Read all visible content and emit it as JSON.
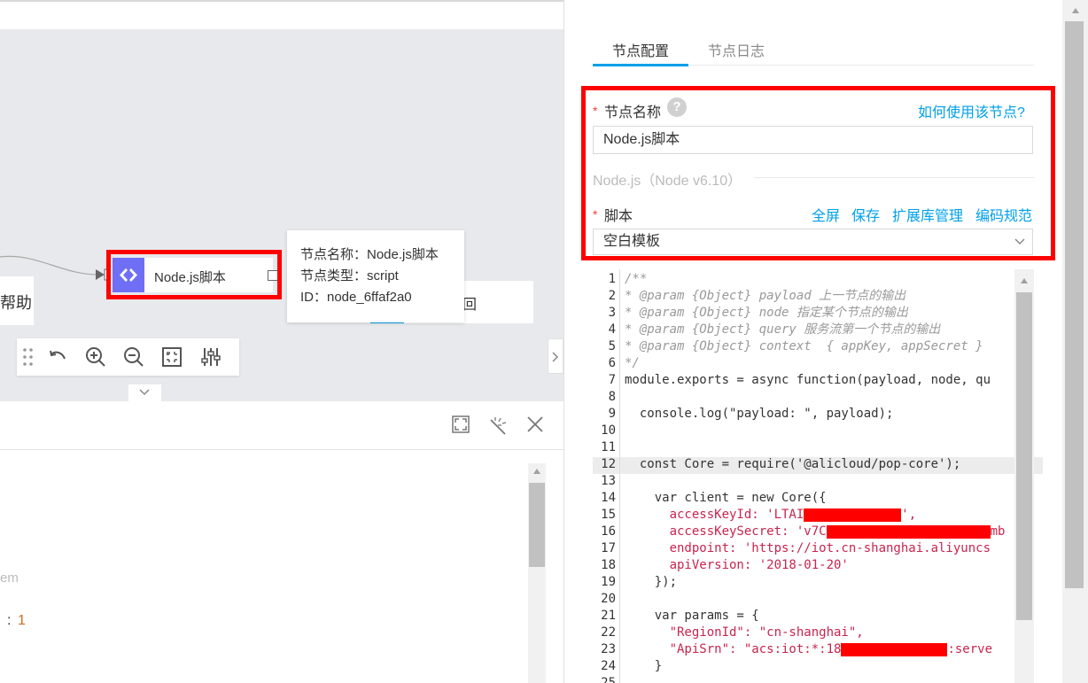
{
  "canvas": {
    "help_text": "帮助",
    "return_text": "回",
    "node_label": "Node.js脚本",
    "tooltip": {
      "name": "节点名称：Node.js脚本",
      "type": "节点类型：script",
      "id": "ID：node_6ffaf2a0"
    },
    "toolbar_icons": [
      "drag-handle-icon",
      "undo-icon",
      "zoom-in-icon",
      "zoom-out-icon",
      "fit-view-icon",
      "settings-sliders-icon"
    ]
  },
  "bottom_panel": {
    "text_fragment": "em",
    "value_prefix": ":",
    "value": "1"
  },
  "right_panel": {
    "tabs": [
      {
        "label": "节点配置",
        "active": true
      },
      {
        "label": "节点日志",
        "active": false
      }
    ],
    "node_name": {
      "label": "节点名称",
      "help_glyph": "?",
      "how_to_link": "如何使用该节点?",
      "value": "Node.js脚本"
    },
    "runtime": "Node.js（Node v6.10）",
    "script": {
      "label": "脚本",
      "actions": [
        "全屏",
        "保存",
        "扩展库管理",
        "编码规范"
      ],
      "template": "空白模板"
    },
    "code_lines": [
      {
        "n": "1",
        "text": "/**"
      },
      {
        "n": "2",
        "text": "* @param {Object} payload 上一节点的输出"
      },
      {
        "n": "3",
        "text": "* @param {Object} node 指定某个节点的输出"
      },
      {
        "n": "4",
        "text": "* @param {Object} query 服务流第一个节点的输出"
      },
      {
        "n": "5",
        "text": "* @param {Object} context  { appKey, appSecret }"
      },
      {
        "n": "6",
        "text": "*/"
      },
      {
        "n": "7",
        "text": "module.exports = async function(payload, node, qu"
      },
      {
        "n": "8",
        "text": ""
      },
      {
        "n": "9",
        "text": "  console.log(\"payload: \", payload);"
      },
      {
        "n": "10",
        "text": ""
      },
      {
        "n": "11",
        "text": ""
      },
      {
        "n": "12",
        "text": "  const Core = require('@alicloud/pop-core');"
      },
      {
        "n": "13",
        "text": ""
      },
      {
        "n": "14",
        "text": "    var client = new Core({"
      },
      {
        "n": "15",
        "text": "      accessKeyId: 'LTAI"
      },
      {
        "n": "16",
        "text": "      accessKeySecret: 'v7C"
      },
      {
        "n": "17",
        "text": "      endpoint: 'https://iot.cn-shanghai.aliyuncs"
      },
      {
        "n": "18",
        "text": "      apiVersion: '2018-01-20'"
      },
      {
        "n": "19",
        "text": "    });"
      },
      {
        "n": "20",
        "text": ""
      },
      {
        "n": "21",
        "text": "    var params = {"
      },
      {
        "n": "22",
        "text": "      \"RegionId\": \"cn-shanghai\","
      },
      {
        "n": "23",
        "text": "      \"ApiSrn\": \"acs:iot:*:18"
      },
      {
        "n": "24",
        "text": "    }"
      },
      {
        "n": "25",
        "text": ""
      }
    ],
    "code_tail": {
      "line15": "',",
      "line16": "mb",
      "line23": ":serve"
    }
  },
  "colors": {
    "accent": "#00a0e9",
    "highlight_box": "#ff0000",
    "node_icon_bg": "#6f6ff5",
    "required_star": "#f04134"
  }
}
